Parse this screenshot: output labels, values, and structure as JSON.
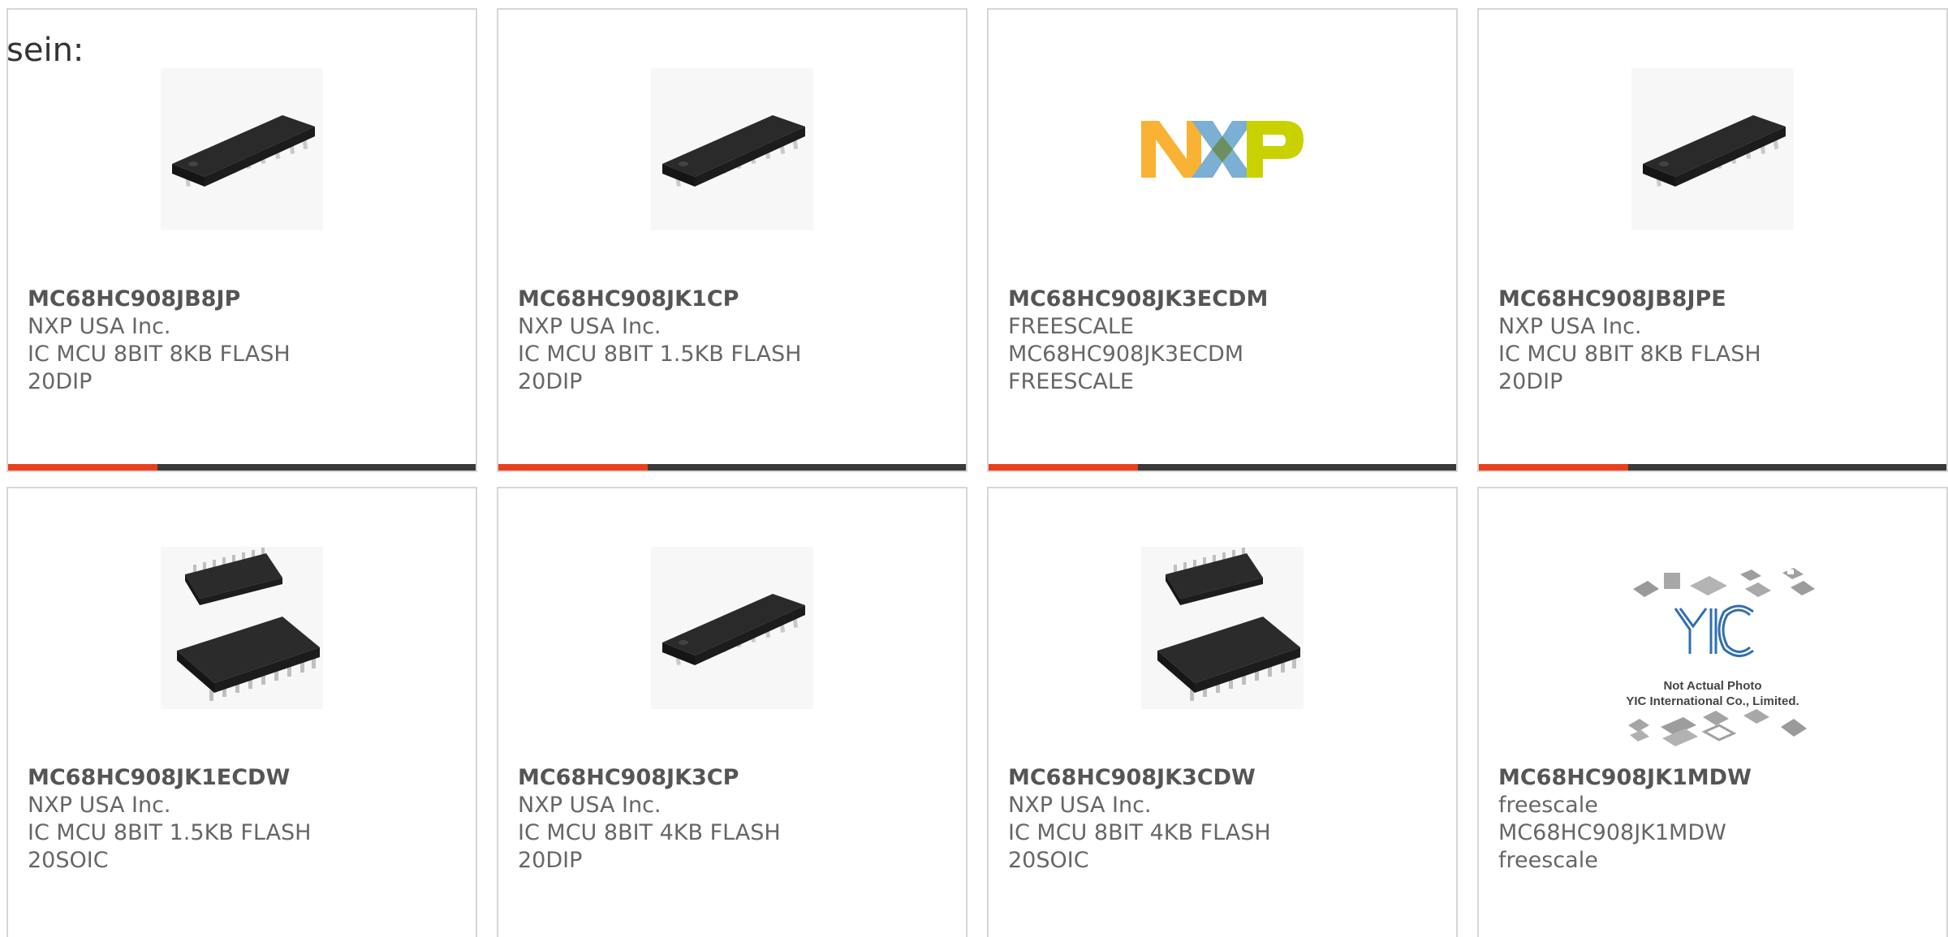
{
  "intro_text": "sein:",
  "colors": {
    "accent": "#e8401c",
    "bar": "#3a3a3a",
    "border": "#d6d6d6",
    "text": "#555555"
  },
  "accent_fraction": 0.32,
  "products": [
    {
      "part": "MC68HC908JB8JP",
      "maker": "NXP USA Inc.",
      "desc": "IC MCU 8BIT 8KB FLASH 20DIP",
      "image": "dip-chip-icon"
    },
    {
      "part": "MC68HC908JK1CP",
      "maker": "NXP USA Inc.",
      "desc": "IC MCU 8BIT 1.5KB FLASH 20DIP",
      "image": "dip-chip-icon"
    },
    {
      "part": "MC68HC908JK3ECDM",
      "maker": "FREESCALE",
      "desc": "MC68HC908JK3ECDM FREESCALE",
      "image": "nxp-logo"
    },
    {
      "part": "MC68HC908JB8JPE",
      "maker": "NXP USA Inc.",
      "desc": "IC MCU 8BIT 8KB FLASH 20DIP",
      "image": "dip-chip-icon"
    },
    {
      "part": "MC68HC908JK1ECDW",
      "maker": "NXP USA Inc.",
      "desc": "IC MCU 8BIT 1.5KB FLASH 20SOIC",
      "image": "soic-chip-icon"
    },
    {
      "part": "MC68HC908JK3CP",
      "maker": "NXP USA Inc.",
      "desc": "IC MCU 8BIT 4KB FLASH 20DIP",
      "image": "dip-chip-icon"
    },
    {
      "part": "MC68HC908JK3CDW",
      "maker": "NXP USA Inc.",
      "desc": "IC MCU 8BIT 4KB FLASH 20SOIC",
      "image": "soic-chip-icon"
    },
    {
      "part": "MC68HC908JK1MDW",
      "maker": "freescale",
      "desc": "MC68HC908JK1MDW freescale",
      "image": "not-actual-photo",
      "placeholder_lines": [
        "Not Actual Photo",
        "YIC International Co., Limited."
      ]
    }
  ]
}
